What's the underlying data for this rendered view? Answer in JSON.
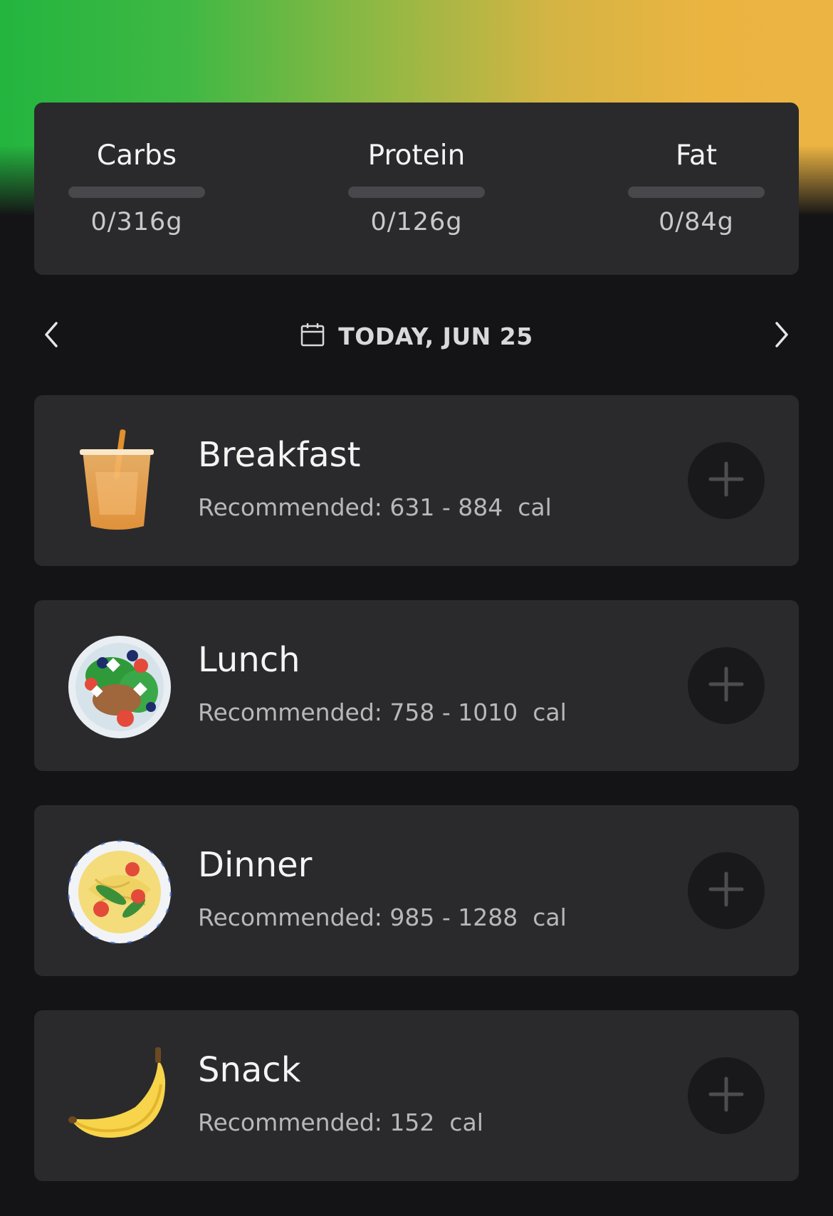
{
  "theme": {
    "accent_green": "#23b53f",
    "accent_yellow": "#ecb443",
    "card_bg": "#2a2a2c",
    "page_bg": "#141416"
  },
  "macros": [
    {
      "name": "Carbs",
      "value": "0/316g",
      "progress": 0
    },
    {
      "name": "Protein",
      "value": "0/126g",
      "progress": 0
    },
    {
      "name": "Fat",
      "value": "0/84g",
      "progress": 0
    }
  ],
  "date_nav": {
    "label": "TODAY, JUN 25",
    "prev_icon": "chevron-left-icon",
    "next_icon": "chevron-right-icon",
    "calendar_icon": "calendar-icon"
  },
  "meals": [
    {
      "title": "Breakfast",
      "subtitle": "Recommended: 631 - 884  cal",
      "icon": "iced-drink-icon"
    },
    {
      "title": "Lunch",
      "subtitle": "Recommended: 758 - 1010  cal",
      "icon": "salad-bowl-icon"
    },
    {
      "title": "Dinner",
      "subtitle": "Recommended: 985 - 1288  cal",
      "icon": "pasta-plate-icon"
    },
    {
      "title": "Snack",
      "subtitle": "Recommended: 152  cal",
      "icon": "banana-icon"
    }
  ]
}
